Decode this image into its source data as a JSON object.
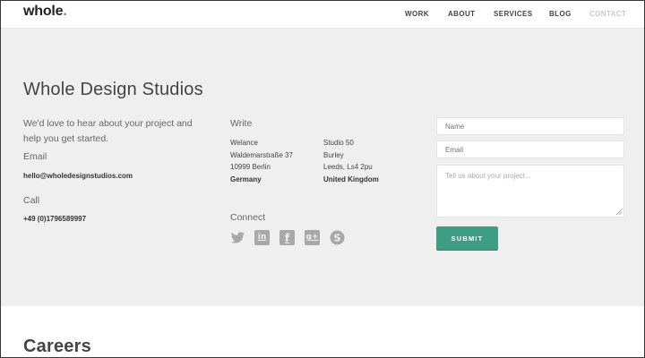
{
  "header": {
    "logo_text": "whole",
    "logo_dot": ".",
    "nav": [
      "WORK",
      "ABOUT",
      "SERVICES",
      "BLOG",
      "CONTACT"
    ],
    "active_nav": "CONTACT"
  },
  "contact": {
    "title": "Whole Design Studios",
    "intro": "We'd love to hear about your project and help you get started.",
    "email_label": "Email",
    "email": "hello@wholedesignstudios.com",
    "call_label": "Call",
    "phone": "+49 (0)1796589997",
    "write_label": "Write",
    "addresses": [
      {
        "line1": "Welance",
        "line2": "Waldemarstraße 37",
        "line3": "10999 Berlin",
        "country": "Germany"
      },
      {
        "line1": "Studio 50",
        "line2": "Burley",
        "line3": "Leeds, Ls4 2pu",
        "country": "United Kingdom"
      }
    ],
    "connect_label": "Connect",
    "social_icons": [
      "twitter-icon",
      "linkedin-icon",
      "facebook-icon",
      "google-plus-icon",
      "skype-icon"
    ],
    "social_glyphs": {
      "linkedin": "in",
      "facebook": "f",
      "google_plus": "g+"
    },
    "form": {
      "name_placeholder": "Name",
      "email_placeholder": "Email",
      "message_placeholder": "Tell us about your project...",
      "submit_label": "SUBMIT"
    }
  },
  "careers": {
    "title": "Careers"
  },
  "colors": {
    "accent": "#3d9e84",
    "section_bg": "#efefef",
    "icon_gray": "#a8a8a8"
  }
}
